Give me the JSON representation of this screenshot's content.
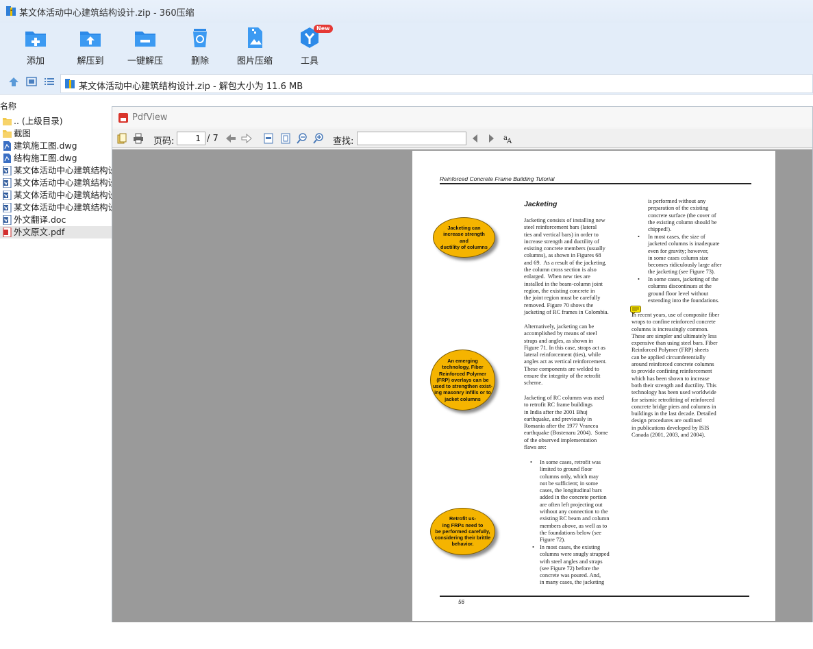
{
  "window": {
    "title": "某文体活动中心建筑结构设计.zip - 360压缩"
  },
  "toolbar": {
    "add": "添加",
    "extract_to": "解压到",
    "one_click": "一键解压",
    "delete": "删除",
    "image_compress": "图片压缩",
    "tools": "工具",
    "new_badge": "New"
  },
  "address": {
    "path": "某文体活动中心建筑结构设计.zip - 解包大小为 11.6 MB"
  },
  "filelist": {
    "column_name": "名称",
    "items": [
      {
        "name": ".. (上级目录)",
        "icon": "folder-icon"
      },
      {
        "name": "截图",
        "icon": "folder-icon"
      },
      {
        "name": "建筑施工图.dwg",
        "icon": "dwg-file-icon"
      },
      {
        "name": "结构施工图.dwg",
        "icon": "dwg-file-icon"
      },
      {
        "name": "某文体活动中心建筑结构设",
        "icon": "word-file-icon"
      },
      {
        "name": "某文体活动中心建筑结构设",
        "icon": "word-file-icon"
      },
      {
        "name": "某文体活动中心建筑结构设",
        "icon": "word-file-icon"
      },
      {
        "name": "某文体活动中心建筑结构设",
        "icon": "word-file-icon"
      },
      {
        "name": "外文翻译.doc",
        "icon": "word-file-icon"
      },
      {
        "name": "外文原文.pdf",
        "icon": "pdf-file-icon"
      }
    ],
    "selected_index": 9
  },
  "pdfview": {
    "title": "PdfView",
    "page_label": "页码:",
    "page_current": "1",
    "page_total": "/ 7",
    "search_label": "查找:",
    "search_value": ""
  },
  "pdf_page": {
    "header": "Reinforced Concrete Frame Building Tutorial",
    "section_title": "Jacketing",
    "page_number": "56",
    "callouts": [
      "Jacketing can\nincrease strength\nand\nductility of columns",
      "An emerging\ntechnology, Fiber\nReinforced Polymer\n(FRP) overlays can be\nused to strengthen exist-\ning masonry infills or to\njacket columns",
      "Retrofit us-\ning FRPs need to\nbe performed carefully,\nconsidering their brittle\nbehavior."
    ],
    "col1_para1": "Jacketing consists of installing new\nsteel reinforcement bars (lateral\nties and vertical bars) in order to\nincrease strength and ductility of\nexisting concrete members (usually\ncolumns), as shown in Figures 68\nand 69.  As a result of the jacketing,\nthe column cross section is also\nenlarged.  When new ties are\ninstalled in the beam-column joint\nregion, the existing concrete in\nthe joint region must be carefully\nremoved. Figure 70 shows the\njacketing of RC frames in Colombia.",
    "col1_para2": "Alternatively, jacketing can be\naccomplished by means of steel\nstraps and angles, as shown in\nFigure 71. In this case, straps act as\nlateral reinforcement (ties), while\nangles act as vertical reinforcement.\nThese components are welded to\nensure the integrity of the retrofit\nscheme.",
    "col1_para3": "Jacketing of RC columns was used\nto retrofit RC frame buildings\nin India after the 2001 Bhuj\nearthquake, and previously in\nRomania after the 1977 Vrancea\nearthquake (Bostenaru 2004).  Some\nof the observed implementation\nflaws are:",
    "col1_bullet1": "In some cases, retrofit was\nlimited to ground floor\ncolumns only, which may\nnot be sufficient; in some\ncases, the longitudinal bars\nadded in the concrete portion\nare often left projecting out\nwithout any connection to the\nexisting RC beam and column\nmembers above, as well as to\nthe foundations below (see\nFigure 72).",
    "col1_bullet2": "In most cases, the existing\ncolumns were snugly strapped\nwith steel angles and straps\n(see Figure 72) before the\nconcrete was poured. And,\nin many cases, the jacketing",
    "col2_cont": "is performed without any\npreparation of the existing\nconcrete surface (the cover of\nthe existing column should be\nchipped!).",
    "col2_bullet1": "In most cases, the size of\njacketed columns is inadequate\neven for gravity; however,\nin some cases column size\nbecomes ridiculously large after\nthe jacketing (see Figure 73).",
    "col2_bullet2": "In some cases, jacketing of the\ncolumns discontinues at the\nground floor level without\nextending into the foundations.",
    "col2_para": "In recent years, use of composite fiber\nwraps to confine reinforced concrete\ncolumns is increasingly common.\nThese are simpler and ultimately less\nexpensive than using steel bars. Fiber\nReinforced Polymer (FRP) sheets\ncan be applied circumferentially\naround reinforced concrete columns\nto provide confining reinforcement\nwhich has been shown to increase\nboth their strength and ductility. This\ntechnology has been used worldwide\nfor seismic retrofitting of reinforced\nconcrete bridge piers and columns in\nbuildings in the last decade. Detailed\ndesign procedures are outlined\nin publications developed by ISIS\nCanada (2001, 2003, and 2004).",
    "bullet_char": "•"
  }
}
